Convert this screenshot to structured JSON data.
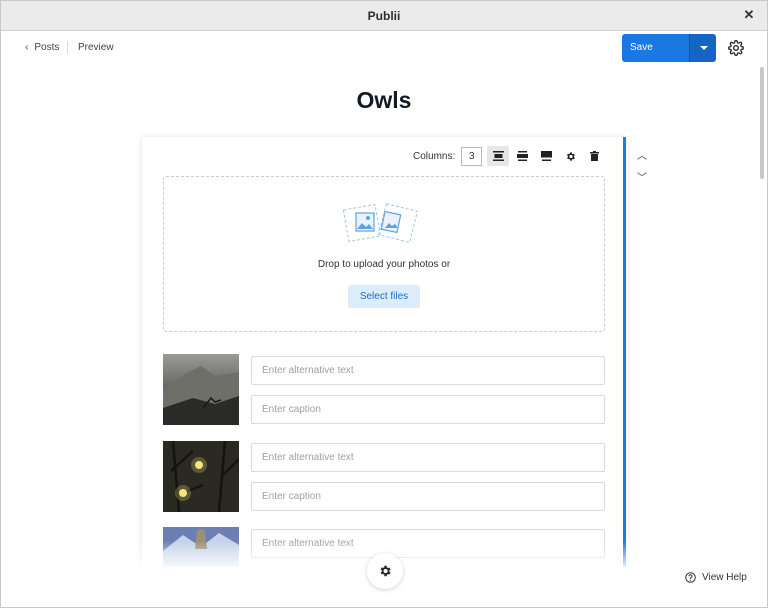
{
  "window": {
    "title": "Publii"
  },
  "nav": {
    "back_label": "Posts",
    "preview_label": "Preview",
    "save_label": "Save"
  },
  "post": {
    "title": "Owls"
  },
  "gallery": {
    "columns_label": "Columns:",
    "columns_value": "3",
    "dropzone_text": "Drop to upload your photos or",
    "select_files_label": "Select files",
    "images": [
      {
        "alt_placeholder": "Enter alternative text",
        "caption_placeholder": "Enter caption"
      },
      {
        "alt_placeholder": "Enter alternative text",
        "caption_placeholder": "Enter caption"
      },
      {
        "alt_placeholder": "Enter alternative text"
      }
    ]
  },
  "footer": {
    "help_label": "View Help"
  },
  "colors": {
    "accent": "#1a78e3",
    "accent_dark": "#1565c7",
    "select_files_bg": "#dcecfb"
  }
}
